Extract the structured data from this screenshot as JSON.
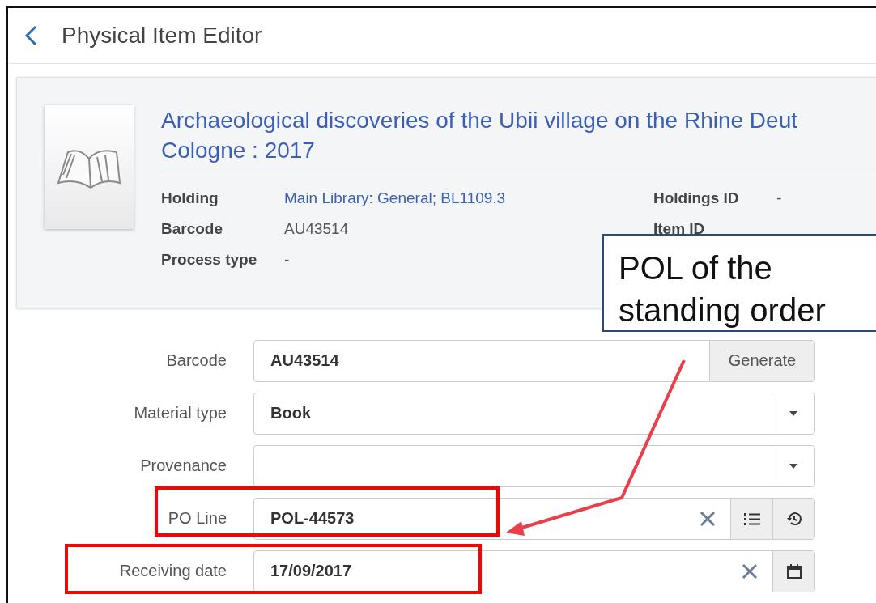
{
  "header": {
    "title": "Physical Item Editor"
  },
  "record": {
    "title": "Archaeological discoveries of the Ubii village on the Rhine Deut",
    "subtitle": "Cologne : 2017",
    "details": [
      {
        "label": "Holding",
        "value": "Main Library: General; BL1109.3",
        "link": true
      },
      {
        "label": "Holdings ID",
        "value": "-",
        "link": false
      },
      {
        "label": "Barcode",
        "value": "AU43514",
        "link": false
      },
      {
        "label": "Item ID"
      },
      {
        "label": "Process type",
        "value": "-",
        "link": false
      }
    ]
  },
  "form": [
    {
      "label": "Barcode",
      "value": "AU43514",
      "kind": "generate",
      "button": "Generate",
      "highlighted": false
    },
    {
      "label": "Material type",
      "value": "Book",
      "kind": "select",
      "highlighted": false
    },
    {
      "label": "Provenance",
      "kind": "select",
      "highlighted": false
    },
    {
      "label": "PO Line",
      "value": "POL-44573",
      "kind": "lookup",
      "highlighted": true
    },
    {
      "label": "Receiving date",
      "value": "17/09/2017",
      "kind": "date",
      "highlighted": true
    }
  ],
  "callout": {
    "text": "POL of the standing order"
  }
}
